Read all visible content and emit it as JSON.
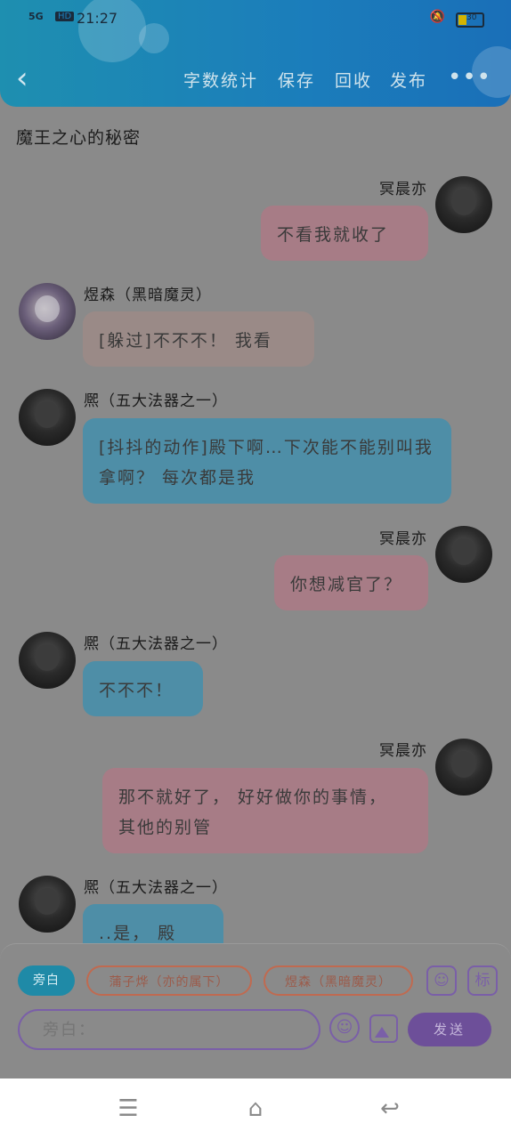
{
  "status_bar": {
    "network": "5G",
    "hd": "HD",
    "time": "21:27",
    "battery": "30"
  },
  "header": {
    "back_icon": "chevron-left-icon",
    "menu": [
      "字数统计",
      "保存",
      "回收",
      "发布"
    ],
    "more_icon": "more-dots-icon"
  },
  "title": "魔王之心的秘密",
  "messages": [
    {
      "name": "冥晨亦",
      "text": "不看我就收了",
      "side": "right",
      "color": "pink"
    },
    {
      "name": "煜森（黑暗魔灵）",
      "text": "[躲过]不不不！ 我看",
      "side": "left",
      "color": "taupe"
    },
    {
      "name": "熈（五大法器之一）",
      "text": "[抖抖的动作]殿下啊…下次能不能别叫我拿啊？ 每次都是我",
      "side": "left",
      "color": "blue"
    },
    {
      "name": "冥晨亦",
      "text": "你想减官了？",
      "side": "right",
      "color": "pink"
    },
    {
      "name": "熈（五大法器之一）",
      "text": "不不不！",
      "side": "left",
      "color": "blue"
    },
    {
      "name": "冥晨亦",
      "text": "那不就好了， 好好做你的事情， 其他的别管",
      "side": "right",
      "color": "pink"
    },
    {
      "name": "熈（五大法器之一）",
      "text": "..是， 殿下..",
      "side": "left",
      "color": "blue"
    }
  ],
  "composer": {
    "chips": [
      "旁白",
      "蒲子烨（亦的属下）",
      "煜森（黑暗魔灵）"
    ],
    "person_icon": "person-card-icon",
    "tag_label": "标",
    "input_placeholder": "旁白：",
    "emoji_icon": "emoji-icon",
    "image_icon": "image-icon",
    "send_label": "发送"
  },
  "nav_bar": {
    "menu_icon": "menu-icon",
    "home_icon": "home-icon",
    "back_icon": "back-icon"
  }
}
